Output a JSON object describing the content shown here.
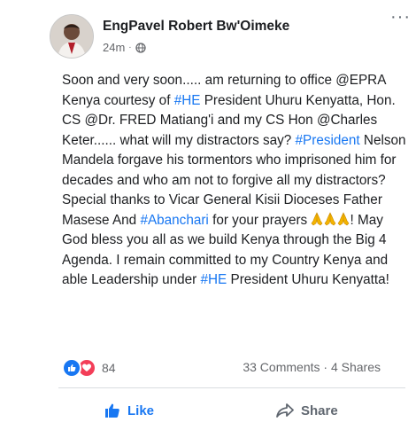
{
  "post": {
    "author": "EngPavel Robert Bw'Oimeke",
    "time": "24m",
    "time_separator": "·",
    "more": "···",
    "paragraph": [
      {
        "t": "Soon and very soon..... am returning to office ",
        "tag": false
      },
      {
        "t": "@EPRA Kenya",
        "tag": false
      },
      {
        "t": " courtesy of ",
        "tag": false
      },
      {
        "t": "#HE",
        "tag": true
      },
      {
        "t": " President Uhuru Kenyatta, Hon. CS ",
        "tag": false
      },
      {
        "t": "@Dr. FRED Matiang'i",
        "tag": false
      },
      {
        "t": " and my CS Hon ",
        "tag": false
      },
      {
        "t": "@Charles Keter",
        "tag": false
      },
      {
        "t": "...... what will my distractors say? ",
        "tag": false
      },
      {
        "t": "#President",
        "tag": true
      },
      {
        "t": " Nelson Mandela forgave his tormentors who imprisoned him for decades  and who am not to forgive all my distractors? Special thanks to Vicar General Kisii Dioceses Father Masese And ",
        "tag": false
      },
      {
        "t": "#Abanchari",
        "tag": true
      },
      {
        "t": "  for your prayers  ",
        "tag": false
      }
    ],
    "paragraph_end": [
      {
        "t": "! May God bless you all as we build Kenya through the Big 4 Agenda. I remain committed to my Country Kenya and able Leadership under ",
        "tag": false
      },
      {
        "t": "#HE",
        "tag": true
      },
      {
        "t": " President Uhuru Kenyatta!",
        "tag": false
      }
    ],
    "prayer_emoji_count": 3
  },
  "reactions": {
    "count": "84",
    "icons": [
      "like-icon",
      "love-icon"
    ],
    "comments": "33 Comments",
    "separator": " · ",
    "shares": "4 Shares"
  },
  "actions": {
    "like_label": "Like",
    "share_label": "Share"
  },
  "colors": {
    "link": "#1877f2",
    "like": "#1877f2",
    "love": "#f33e58",
    "muted": "#65676b"
  }
}
